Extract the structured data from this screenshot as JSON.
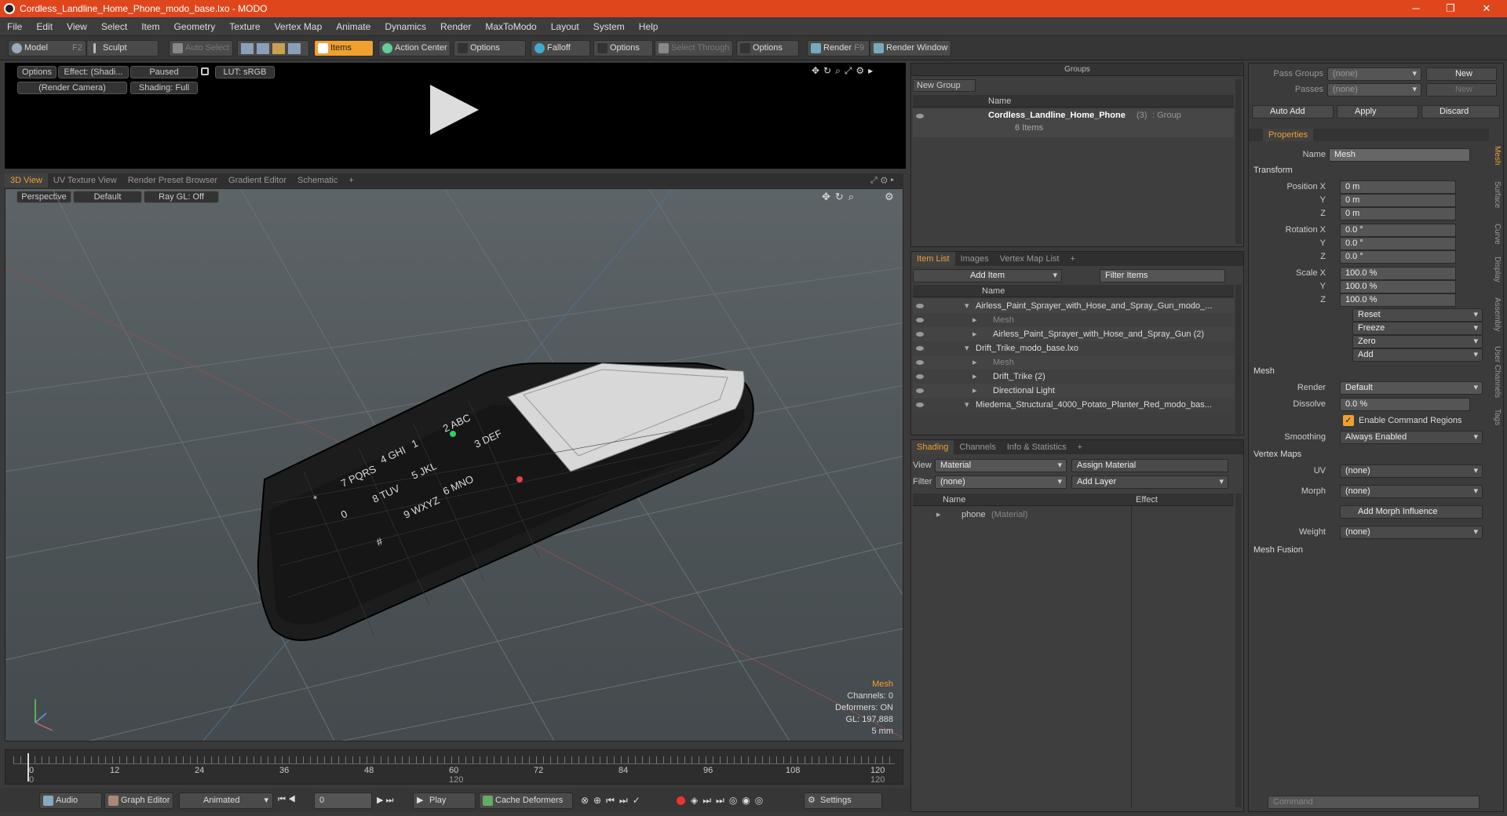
{
  "window": {
    "title": "Cordless_Landline_Home_Phone_modo_base.lxo - MODO"
  },
  "menu": [
    "File",
    "Edit",
    "View",
    "Select",
    "Item",
    "Geometry",
    "Texture",
    "Vertex Map",
    "Animate",
    "Dynamics",
    "Render",
    "MaxToModo",
    "Layout",
    "System",
    "Help"
  ],
  "toolbar": {
    "model": "Model",
    "model_key": "F2",
    "sculpt": "Sculpt",
    "auto_select": "Auto Select",
    "items": "Items",
    "action_center": "Action Center",
    "options1": "Options",
    "falloff": "Falloff",
    "options2": "Options",
    "select_through": "Select Through",
    "options3": "Options",
    "render": "Render",
    "render_key": "F9",
    "render_window": "Render Window"
  },
  "preview": {
    "options": "Options",
    "effect": "Effect: (Shadi...",
    "paused": "Paused",
    "lut": "LUT: sRGB",
    "camera": "(Render Camera)",
    "shading": "Shading: Full"
  },
  "viewtabs": [
    "3D View",
    "UV Texture View",
    "Render Preset Browser",
    "Gradient Editor",
    "Schematic",
    "+"
  ],
  "viewport": {
    "perspective": "Perspective",
    "default": "Default",
    "raygl": "Ray GL: Off",
    "hud": {
      "mesh": "Mesh",
      "channels": "Channels: 0",
      "deformers": "Deformers: ON",
      "gl": "GL: 197,888",
      "size": "5 mm"
    },
    "keys": [
      "2 ABC",
      "3 DEF",
      "1",
      "5 JKL",
      "6 MNO",
      "4 GHI",
      "8 TUV",
      "9 WXYZ",
      "7 PQRS",
      "0",
      "#",
      "*"
    ]
  },
  "timeline": {
    "ticks": [
      "0",
      "12",
      "24",
      "36",
      "48",
      "60",
      "72",
      "84",
      "96",
      "108",
      "120"
    ],
    "sub_ticks": [
      "0",
      "120",
      "120"
    ]
  },
  "bottom": {
    "audio": "Audio",
    "graph_editor": "Graph Editor",
    "animated": "Animated",
    "frame": "0",
    "play": "Play",
    "cache": "Cache Deformers",
    "settings": "Settings"
  },
  "groups": {
    "title": "Groups",
    "new_group": "New Group",
    "col_name": "Name",
    "item_name": "Cordless_Landline_Home_Phone",
    "item_count": "(3)",
    "item_type": ": Group",
    "item_sub": "6 Items"
  },
  "itemlist": {
    "tabs": [
      "Item List",
      "Images",
      "Vertex Map List",
      "+"
    ],
    "add_item": "Add Item",
    "filter": "Filter Items",
    "col_name": "Name",
    "rows": [
      {
        "text": "Airless_Paint_Sprayer_with_Hose_and_Spray_Gun_modo_...",
        "indent": 0,
        "dim": false
      },
      {
        "text": "Mesh",
        "indent": 1,
        "dim": true
      },
      {
        "text": "Airless_Paint_Sprayer_with_Hose_and_Spray_Gun (2)",
        "indent": 1,
        "dim": false
      },
      {
        "text": "Drift_Trike_modo_base.lxo",
        "indent": 0,
        "dim": false
      },
      {
        "text": "Mesh",
        "indent": 1,
        "dim": true
      },
      {
        "text": "Drift_Trike (2)",
        "indent": 1,
        "dim": false
      },
      {
        "text": "Directional Light",
        "indent": 1,
        "dim": false
      },
      {
        "text": "Miedema_Structural_4000_Potato_Planter_Red_modo_bas...",
        "indent": 0,
        "dim": false
      }
    ]
  },
  "shading": {
    "tabs": [
      "Shading",
      "Channels",
      "Info & Statistics",
      "+"
    ],
    "view_label": "View",
    "view_value": "Material",
    "assign": "Assign Material",
    "filter_label": "Filter",
    "filter_value": "(none)",
    "add_layer": "Add Layer",
    "col_name": "Name",
    "col_effect": "Effect",
    "row_name": "phone",
    "row_type": "(Material)"
  },
  "props": {
    "pass_groups": "Pass Groups",
    "pass_groups_val": "(none)",
    "new": "New",
    "passes": "Passes",
    "passes_val": "(none)",
    "new2": "New",
    "auto_add": "Auto Add",
    "apply": "Apply",
    "discard": "Discard",
    "tab": "Properties",
    "name_label": "Name",
    "name_val": "Mesh",
    "transform": "Transform",
    "pos_label": "Position X",
    "pos": [
      "0 m",
      "0 m",
      "0 m"
    ],
    "rot_label": "Rotation X",
    "rot": [
      "0.0 °",
      "0.0 °",
      "0.0 °"
    ],
    "scale_label": "Scale X",
    "scale": [
      "100.0 %",
      "100.0 %",
      "100.0 %"
    ],
    "y": "Y",
    "z": "Z",
    "reset": "Reset",
    "freeze": "Freeze",
    "zero": "Zero",
    "add": "Add",
    "mesh": "Mesh",
    "render_label": "Render",
    "render_val": "Default",
    "dissolve_label": "Dissolve",
    "dissolve_val": "0.0 %",
    "enable_cmd": "Enable Command Regions",
    "smoothing_label": "Smoothing",
    "smoothing_val": "Always Enabled",
    "vertex_maps": "Vertex Maps",
    "uv_label": "UV",
    "uv_val": "(none)",
    "morph_label": "Morph",
    "morph_val": "(none)",
    "add_morph": "Add Morph Influence",
    "weight_label": "Weight",
    "weight_val": "(none)",
    "mesh_fusion": "Mesh Fusion",
    "side_tabs": [
      "Mesh",
      "Surface",
      "Curve",
      "Display",
      "Assembly",
      "User Channels",
      "Tags"
    ],
    "command": "Command"
  }
}
